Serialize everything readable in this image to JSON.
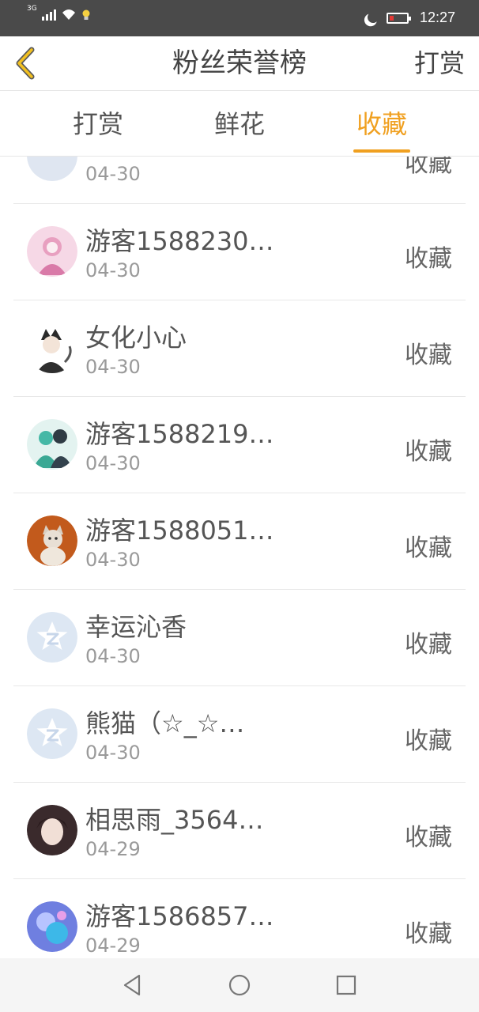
{
  "status_bar": {
    "network": "3G",
    "time": "12:27"
  },
  "header": {
    "title": "粉丝荣誉榜",
    "right_action": "打赏"
  },
  "tabs": [
    {
      "label": "打赏",
      "active": false
    },
    {
      "label": "鲜花",
      "active": false
    },
    {
      "label": "收藏",
      "active": true
    }
  ],
  "colors": {
    "accent": "#f0a020",
    "status_bar": "#4a4a4a"
  },
  "list": [
    {
      "name": "",
      "date": "04-30",
      "action": "收藏",
      "avatar": "default-avatar-icon"
    },
    {
      "name": "游客1588230…",
      "date": "04-30",
      "action": "收藏",
      "avatar": "anime-avatar-icon"
    },
    {
      "name": "女化小心",
      "date": "04-30",
      "action": "收藏",
      "avatar": "anime-avatar-icon"
    },
    {
      "name": "游客1588219…",
      "date": "04-30",
      "action": "收藏",
      "avatar": "anime-avatar-icon"
    },
    {
      "name": "游客1588051…",
      "date": "04-30",
      "action": "收藏",
      "avatar": "cat-photo-avatar-icon"
    },
    {
      "name": "幸运沁香",
      "date": "04-30",
      "action": "收藏",
      "avatar": "default-avatar-icon"
    },
    {
      "name": "熊猫（☆_☆…",
      "date": "04-30",
      "action": "收藏",
      "avatar": "default-avatar-icon"
    },
    {
      "name": "相思雨_3564…",
      "date": "04-29",
      "action": "收藏",
      "avatar": "photo-avatar-icon"
    },
    {
      "name": "游客1586857…",
      "date": "04-29",
      "action": "收藏",
      "avatar": "anime-avatar-icon"
    }
  ],
  "nav_bar": {
    "back": "back-triangle-icon",
    "home": "home-circle-icon",
    "recents": "recents-square-icon"
  }
}
